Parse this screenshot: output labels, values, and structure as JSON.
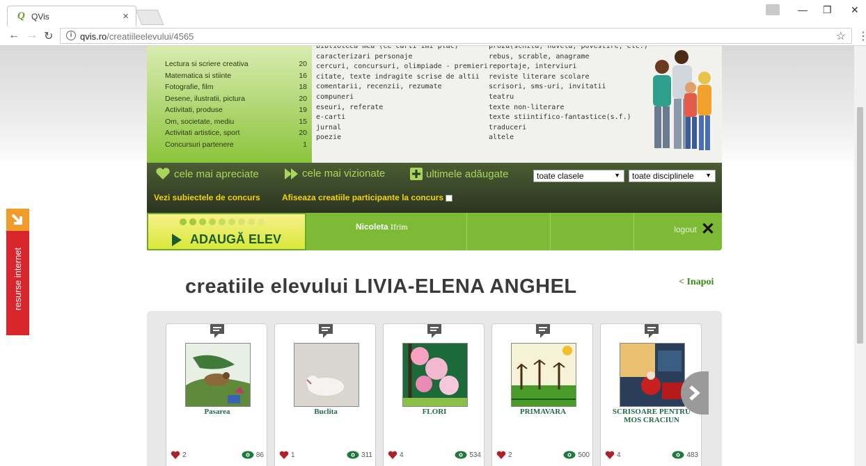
{
  "browser": {
    "tab_title": "QVis",
    "tab_favicon": "Q",
    "url_host": "qvis.ro",
    "url_path": "/creatiileelevului/4565"
  },
  "sidebar_tab": {
    "label": "resurse internet"
  },
  "categories": [
    {
      "name": "Lectura si scriere creativa",
      "count": "20"
    },
    {
      "name": "Matematica si stiinte",
      "count": "16"
    },
    {
      "name": "Fotografie, film",
      "count": "18"
    },
    {
      "name": "Desene, ilustratii, pictura",
      "count": "20"
    },
    {
      "name": "Activitati, produse",
      "count": "19"
    },
    {
      "name": "Om, societate, mediu",
      "count": "15"
    },
    {
      "name": "Activitati artistice, sport",
      "count": "20"
    },
    {
      "name": "Concursuri partenere",
      "count": "1"
    }
  ],
  "genres_left": [
    "biblioteca mea (ce carti imi plac)",
    "caracterizari personaje",
    "cercuri, concursuri, olimpiade - premieri",
    "citate, texte indragite scrise de altii",
    "comentarii, recenzii, rezumate",
    "compuneri",
    "eseuri, referate",
    "e-carti",
    "jurnal",
    "poezie"
  ],
  "genres_right": [
    "proza(schita, nuvela, povestire, etc.)",
    "rebus, scrable, anagrame",
    "reportaje, interviuri",
    "reviste literare scolare",
    "scrisori, sms-uri, invitatii",
    "teatru",
    "texte non-literare",
    "texte stiintifico-fantastice(s.f.)",
    "traduceri",
    "altele"
  ],
  "nav": {
    "most_liked": "cele mai apreciate",
    "most_viewed": "cele mai vizionate",
    "latest": "ultimele adăugate",
    "class_select": "toate clasele",
    "discipline_select": "toate disciplinele",
    "contest_subjects": "Vezi subiectele de concurs",
    "show_contest": "Afiseaza creatiile participante la concurs"
  },
  "userbar": {
    "add_student": "ADAUGĂ ELEV",
    "first_name": "Nicoleta",
    "last_name": "Ifrim",
    "logout": "logout"
  },
  "page": {
    "heading": "creatiile elevului LIVIA-ELENA ANGHEL",
    "back": "< Inapoi"
  },
  "cards": [
    {
      "title": "Pasarea",
      "likes": "2",
      "views": "86"
    },
    {
      "title": "Buclita",
      "likes": "1",
      "views": "311"
    },
    {
      "title": "FLORI",
      "likes": "4",
      "views": "534"
    },
    {
      "title": "PRIMAVARA",
      "likes": "2",
      "views": "500"
    },
    {
      "title": "SCRISOARE PENTRU MOS CRACIUN",
      "likes": "4",
      "views": "483"
    }
  ],
  "colors": {
    "brand_green": "#7dbb37",
    "nav_dark": "#3a4a2a",
    "heart": "#b0202a",
    "eye": "#1e7a3c",
    "side_red": "#d9262c",
    "side_orange": "#f19b2c"
  }
}
